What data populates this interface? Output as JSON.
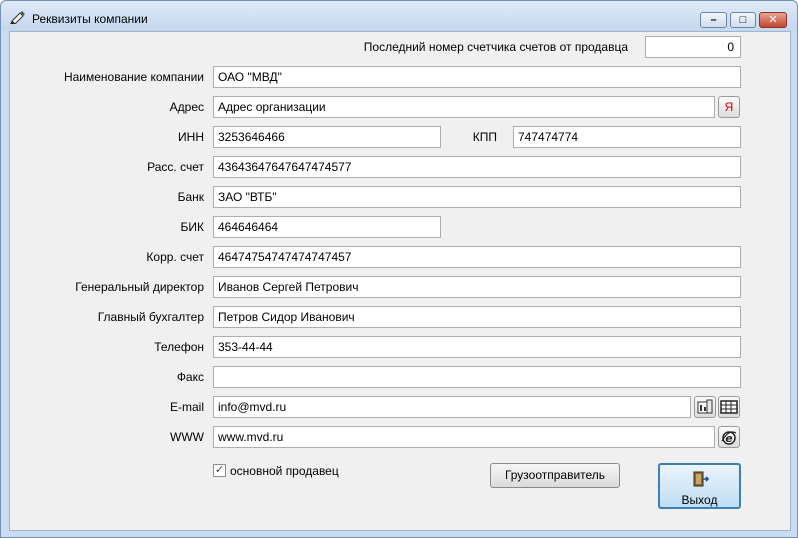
{
  "window": {
    "title": "Реквизиты компании",
    "minimize_glyph": "–",
    "maximize_glyph": "□",
    "close_glyph": "✕"
  },
  "counter": {
    "label": "Последний номер счетчика счетов от продавца",
    "value": "0"
  },
  "fields": {
    "company_name": {
      "label": "Наименование компании",
      "value": "ОАО \"МВД\""
    },
    "address": {
      "label": "Адрес",
      "value": "Адрес организации",
      "map_button": "Я"
    },
    "inn": {
      "label": "ИНН",
      "value": "3253646466"
    },
    "kpp": {
      "label": "КПП",
      "value": "747474774"
    },
    "account": {
      "label": "Расс. счет",
      "value": "43643647647647474577"
    },
    "bank": {
      "label": "Банк",
      "value": "ЗАО \"ВТБ\""
    },
    "bik": {
      "label": "БИК",
      "value": "464646464"
    },
    "corr_account": {
      "label": "Корр. счет",
      "value": "46474754747474747457"
    },
    "director": {
      "label": "Генеральный директор",
      "value": "Иванов Сергей Петрович"
    },
    "accountant": {
      "label": "Главный бухгалтер",
      "value": "Петров Сидор Иванович"
    },
    "phone": {
      "label": "Телефон",
      "value": "353-44-44"
    },
    "fax": {
      "label": "Факс",
      "value": ""
    },
    "email": {
      "label": "E-mail",
      "value": "info@mvd.ru"
    },
    "www": {
      "label": "WWW",
      "value": "www.mvd.ru"
    }
  },
  "checkbox": {
    "label": "основной продавец",
    "checked": true,
    "mark": "✓"
  },
  "buttons": {
    "shipper": "Грузоотправитель",
    "exit": "Выход"
  },
  "icons": {
    "title": "pencil-icon",
    "email_send": "mail-send-icon",
    "email_table": "table-icon",
    "www_open": "browser-icon",
    "exit": "exit-door-icon"
  },
  "colors": {
    "frame": "#c9dcf1",
    "client": "#f0f0f0",
    "close_button": "#c4452d",
    "exit_button_border": "#3c7fb1",
    "map_button_text": "#cc0000"
  }
}
